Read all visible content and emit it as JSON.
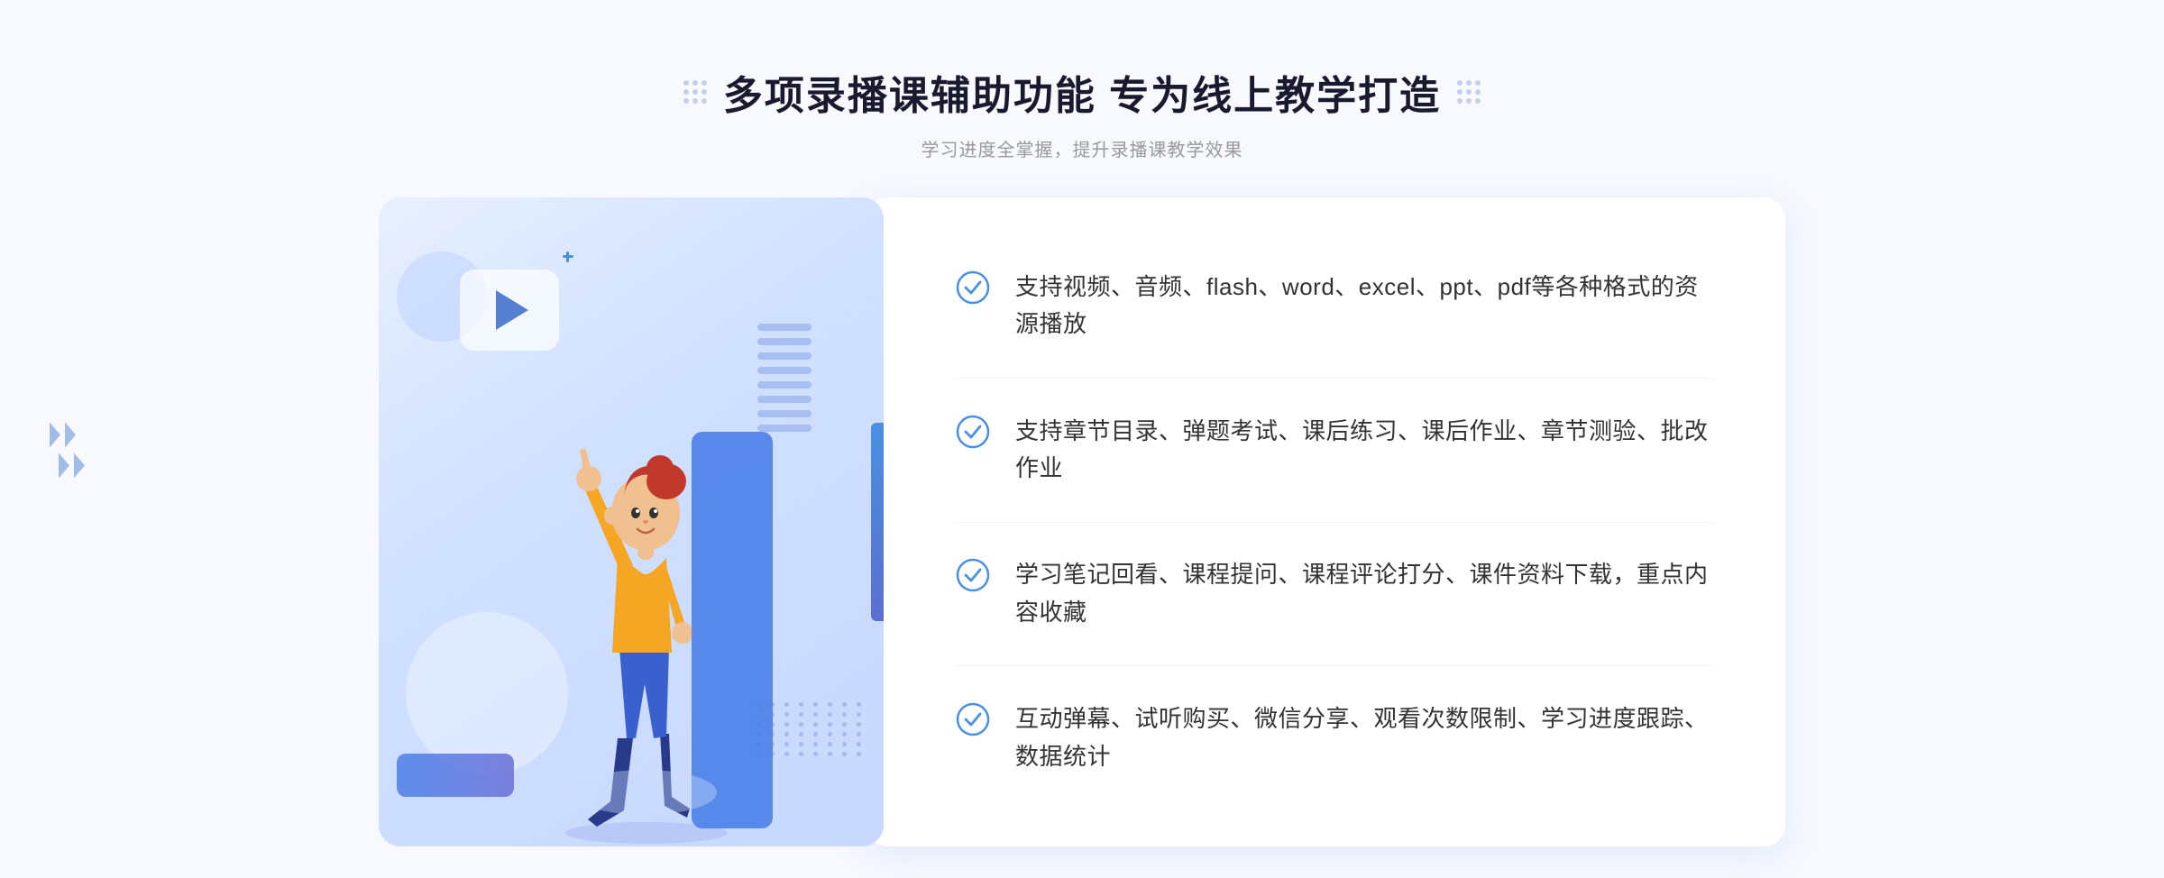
{
  "header": {
    "title": "多项录播课辅助功能 专为线上教学打造",
    "subtitle": "学习进度全掌握，提升录播课教学效果",
    "dots_deco": true
  },
  "features": [
    {
      "id": 1,
      "text": "支持视频、音频、flash、word、excel、ppt、pdf等各种格式的资源播放"
    },
    {
      "id": 2,
      "text": "支持章节目录、弹题考试、课后练习、课后作业、章节测验、批改作业"
    },
    {
      "id": 3,
      "text": "学习笔记回看、课程提问、课程评论打分、课件资料下载，重点内容收藏"
    },
    {
      "id": 4,
      "text": "互动弹幕、试听购买、微信分享、观看次数限制、学习进度跟踪、数据统计"
    }
  ],
  "colors": {
    "accent_blue": "#4a7fe8",
    "light_blue": "#d0e0ff",
    "check_blue": "#4a90e2",
    "text_dark": "#1a1a2e",
    "text_sub": "#999999",
    "text_feature": "#333333"
  }
}
